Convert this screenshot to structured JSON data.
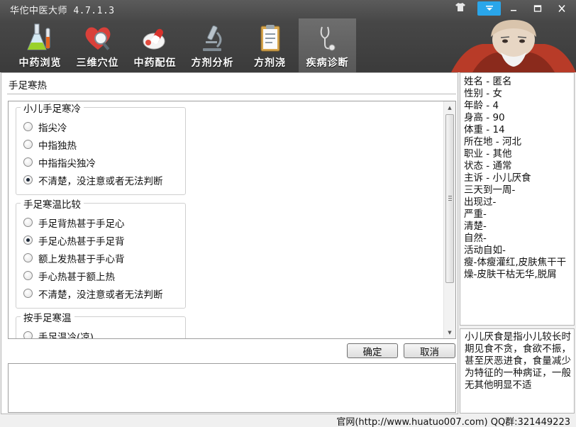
{
  "app": {
    "title": "华佗中医大师 4.7.1.3",
    "colors": {
      "toolbar": "#3b3b3b",
      "active_control": "#2aa6ea",
      "panel_border": "#b5b5b5"
    }
  },
  "window_controls": {
    "skin_icon": "shirt-icon",
    "menu_icon": "dropdown-menu-icon",
    "minimize_icon": "minimize-icon",
    "maximize_icon": "maximize-icon",
    "close_icon": "close-icon"
  },
  "nav": {
    "tabs": [
      {
        "label": "中药浏览",
        "icon": "flask-icon"
      },
      {
        "label": "三维穴位",
        "icon": "heart-magnifier-icon"
      },
      {
        "label": "中药配伍",
        "icon": "pills-icon"
      },
      {
        "label": "方剂分析",
        "icon": "microscope-icon"
      },
      {
        "label": "方剂浇",
        "icon": "clipboard-icon"
      },
      {
        "label": "疾病诊断",
        "icon": "stethoscope-icon",
        "active": true
      }
    ]
  },
  "main": {
    "symptom_title": "手足寒热",
    "groups": [
      {
        "legend": "小儿手足寒冷",
        "options": [
          {
            "label": "指尖冷",
            "checked": false
          },
          {
            "label": "中指独热",
            "checked": false
          },
          {
            "label": "中指指尖独冷",
            "checked": false
          },
          {
            "label": "不清楚，没注意或者无法判断",
            "checked": true
          }
        ]
      },
      {
        "legend": "手足寒温比较",
        "options": [
          {
            "label": "手足背热甚于手足心",
            "checked": false
          },
          {
            "label": "手足心热甚于手足背",
            "checked": true
          },
          {
            "label": "额上发热甚于手心背",
            "checked": false
          },
          {
            "label": "手心热甚于额上热",
            "checked": false
          },
          {
            "label": "不清楚，没注意或者无法判断",
            "checked": false
          }
        ]
      },
      {
        "legend": "按手足寒温",
        "options": [
          {
            "label": "手足温冷(凉)",
            "checked": false
          }
        ]
      }
    ],
    "ok_label": "确定",
    "cancel_label": "取消"
  },
  "patient": {
    "lines": [
      "姓名 - 匿名",
      "性别 - 女",
      "年龄 - 4",
      "身高 - 90",
      "体重 - 14",
      "所在地 - 河北",
      "职业 - 其他",
      "状态 - 通常",
      "主诉 - 小儿厌食",
      "三天到一周-",
      "出现过-",
      "严重-",
      "清楚-",
      "自然-",
      "活动自如-",
      "瘦-体瘦灌红,皮肤焦干干燥-皮肤干枯无华,脱屑"
    ]
  },
  "description": "小儿厌食是指小儿较长时期见食不贪，食欲不振，甚至厌恶进食，食量减少为特征的一种病证，一般无其他明显不适",
  "footer": "官网(http://www.huatuo007.com) QQ群:321449223"
}
